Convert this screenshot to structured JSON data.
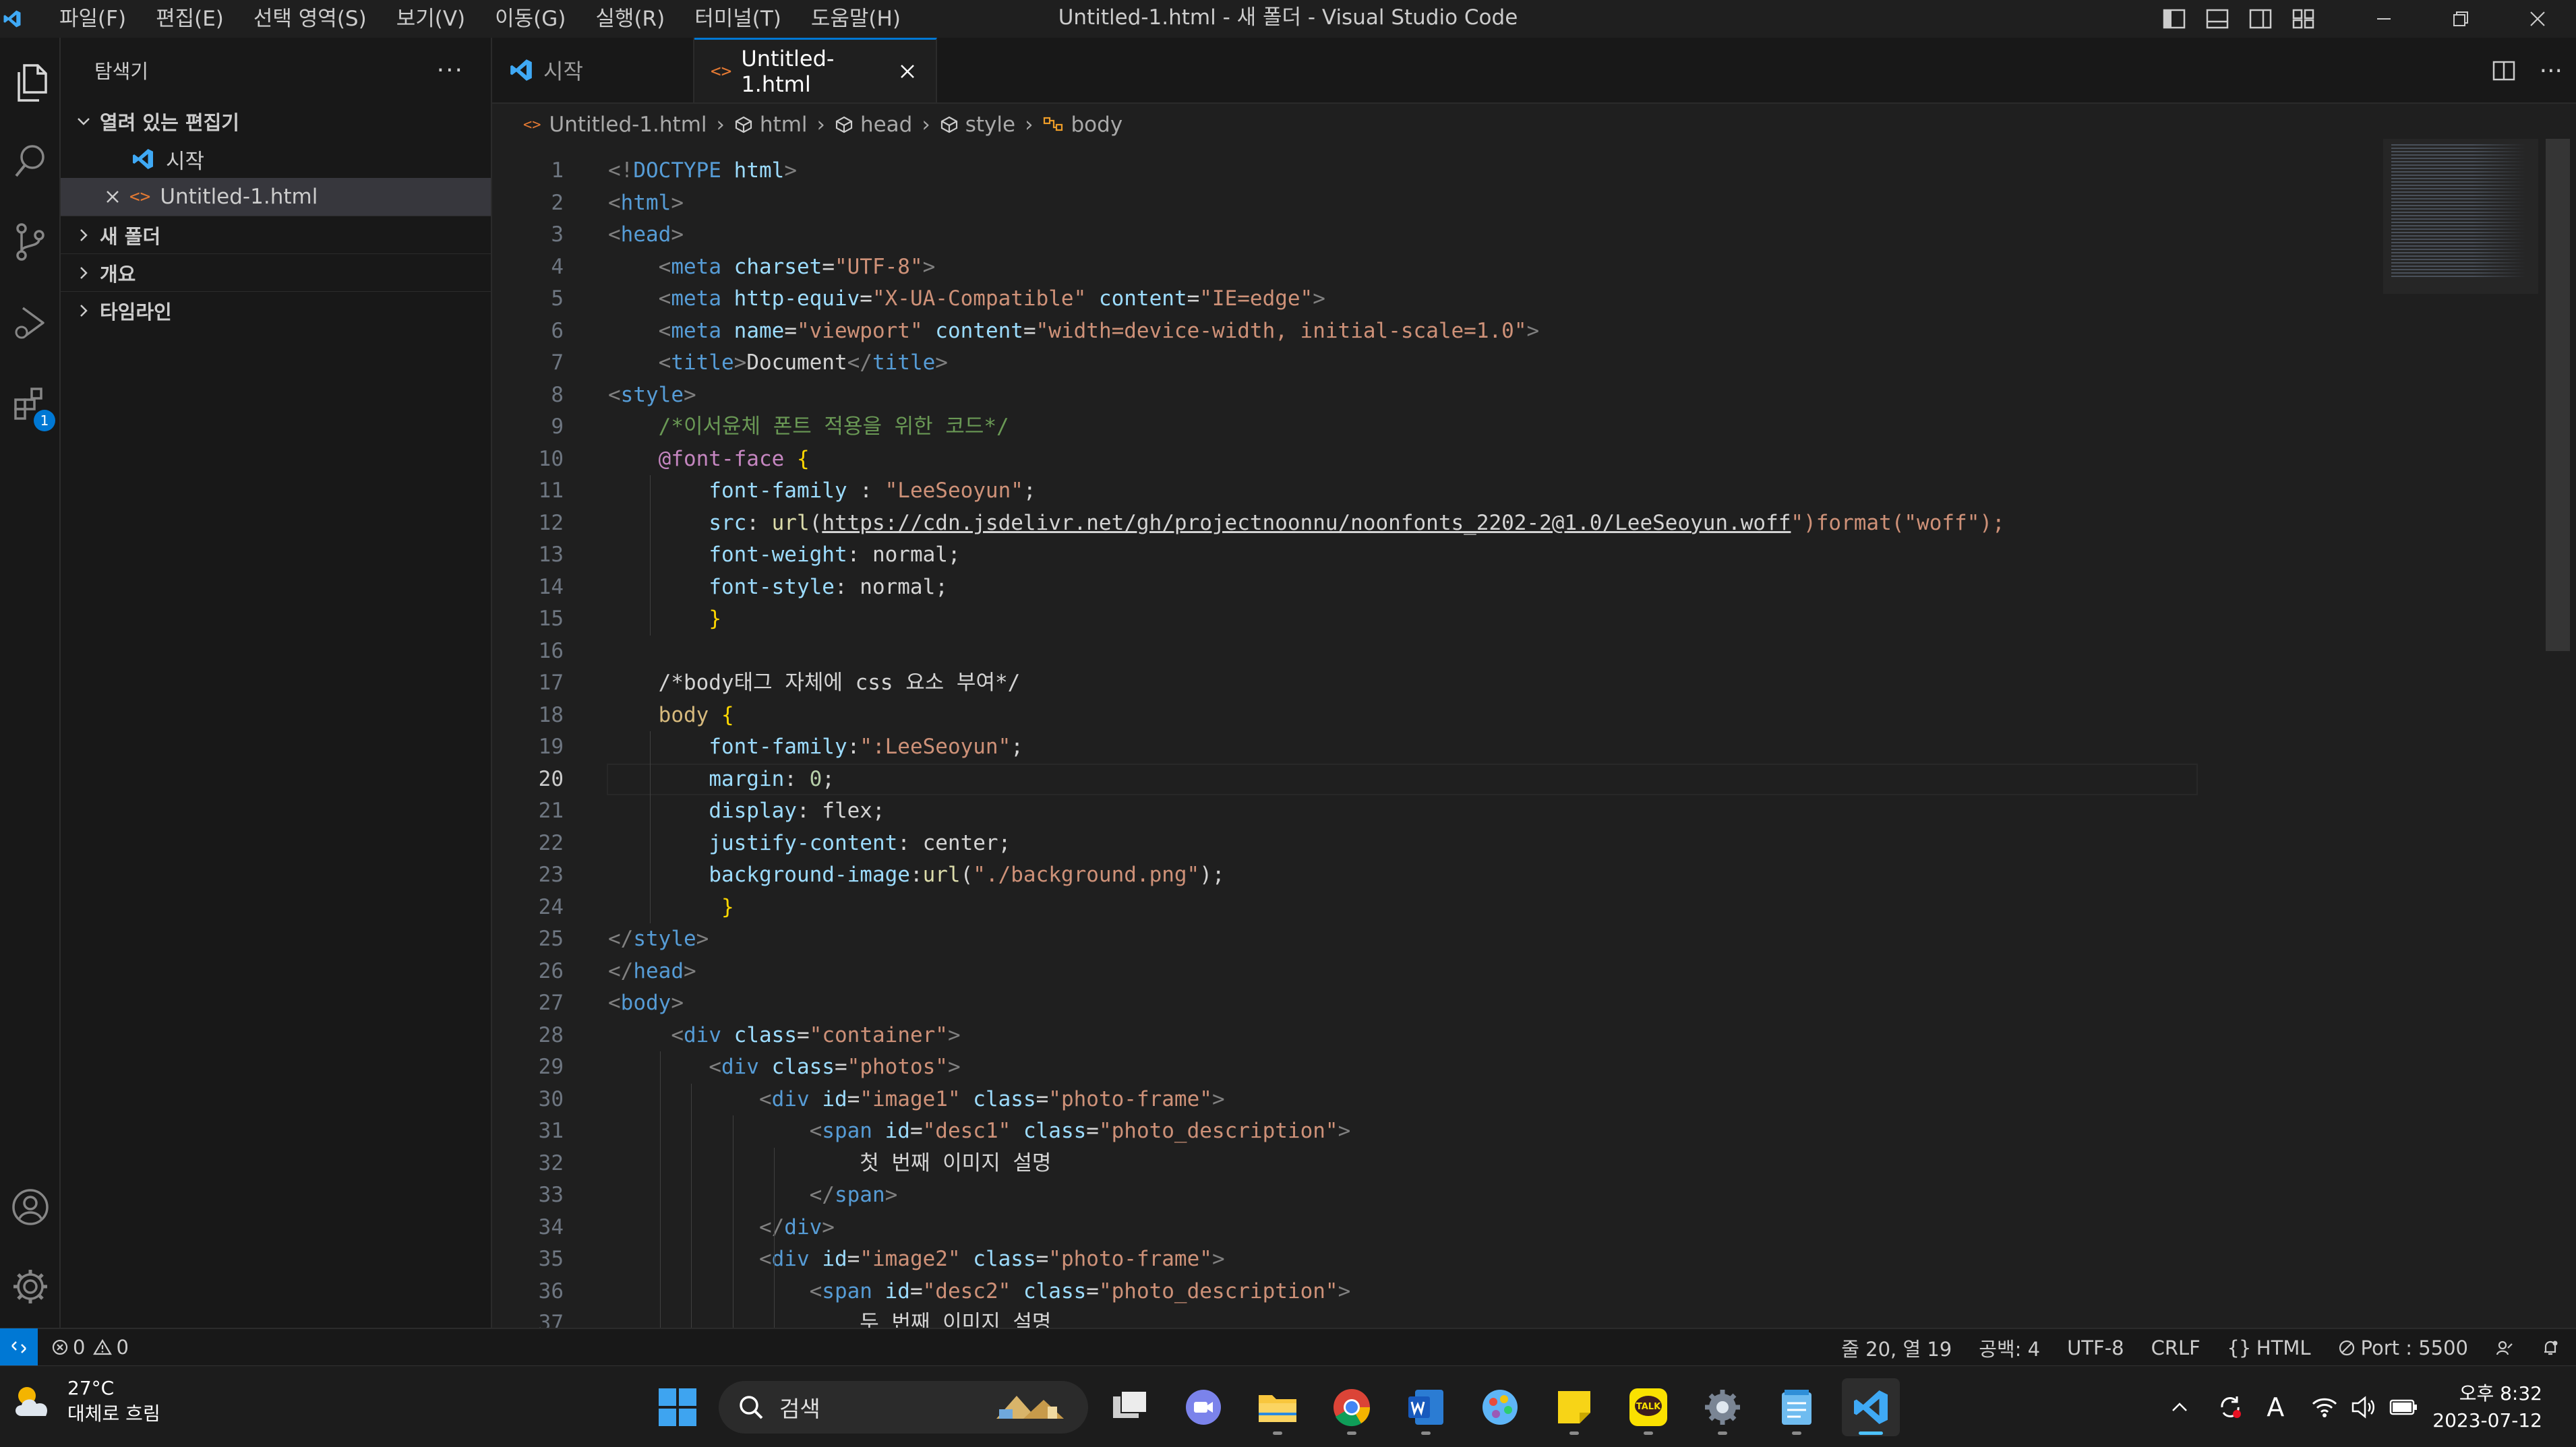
{
  "window": {
    "title": "Untitled-1.html - 새 폴더 - Visual Studio Code",
    "menu": [
      "파일(F)",
      "편집(E)",
      "선택 영역(S)",
      "보기(V)",
      "이동(G)",
      "실행(R)",
      "터미널(T)",
      "도움말(H)"
    ]
  },
  "activity_bar": {
    "items": [
      "explorer",
      "search",
      "source-control",
      "run-debug",
      "extensions"
    ],
    "extensions_badge": "1"
  },
  "sidebar": {
    "title": "탐색기",
    "more": "···",
    "open_editors_label": "열려 있는 편집기",
    "open_editors": [
      {
        "label": "시작",
        "icon": "vscode-icon"
      },
      {
        "label": "Untitled-1.html",
        "icon": "html-icon"
      }
    ],
    "sections": [
      "새 폴더",
      "개요",
      "타임라인"
    ]
  },
  "tabs": [
    {
      "label": "시작",
      "active": false
    },
    {
      "label": "Untitled-1.html",
      "active": true
    }
  ],
  "breadcrumb": [
    "Untitled-1.html",
    "html",
    "head",
    "style",
    "body"
  ],
  "code": {
    "current_line": 20,
    "lines": [
      [
        [
          "br",
          "<!"
        ],
        [
          "tag",
          "DOCTYPE"
        ],
        [
          "txt",
          " "
        ],
        [
          "attr",
          "html"
        ],
        [
          "br",
          ">"
        ]
      ],
      [
        [
          "br",
          "<"
        ],
        [
          "tag",
          "html"
        ],
        [
          "br",
          ">"
        ]
      ],
      [
        [
          "br",
          "<"
        ],
        [
          "tag",
          "head"
        ],
        [
          "br",
          ">"
        ]
      ],
      [
        [
          "txt",
          "    "
        ],
        [
          "br",
          "<"
        ],
        [
          "tag",
          "meta"
        ],
        [
          "txt",
          " "
        ],
        [
          "attr",
          "charset"
        ],
        [
          "txt",
          "="
        ],
        [
          "str",
          "\"UTF-8\""
        ],
        [
          "br",
          ">"
        ]
      ],
      [
        [
          "txt",
          "    "
        ],
        [
          "br",
          "<"
        ],
        [
          "tag",
          "meta"
        ],
        [
          "txt",
          " "
        ],
        [
          "attr",
          "http-equiv"
        ],
        [
          "txt",
          "="
        ],
        [
          "str",
          "\"X-UA-Compatible\""
        ],
        [
          "txt",
          " "
        ],
        [
          "attr",
          "content"
        ],
        [
          "txt",
          "="
        ],
        [
          "str",
          "\"IE=edge\""
        ],
        [
          "br",
          ">"
        ]
      ],
      [
        [
          "txt",
          "    "
        ],
        [
          "br",
          "<"
        ],
        [
          "tag",
          "meta"
        ],
        [
          "txt",
          " "
        ],
        [
          "attr",
          "name"
        ],
        [
          "txt",
          "="
        ],
        [
          "str",
          "\"viewport\""
        ],
        [
          "txt",
          " "
        ],
        [
          "attr",
          "content"
        ],
        [
          "txt",
          "="
        ],
        [
          "str",
          "\"width=device-width, initial-scale=1.0\""
        ],
        [
          "br",
          ">"
        ]
      ],
      [
        [
          "txt",
          "    "
        ],
        [
          "br",
          "<"
        ],
        [
          "tag",
          "title"
        ],
        [
          "br",
          ">"
        ],
        [
          "txt",
          "Document"
        ],
        [
          "br",
          "</"
        ],
        [
          "tag",
          "title"
        ],
        [
          "br",
          ">"
        ]
      ],
      [
        [
          "br",
          "<"
        ],
        [
          "tag",
          "style"
        ],
        [
          "br",
          ">"
        ]
      ],
      [
        [
          "txt",
          "    "
        ],
        [
          "cmt",
          "/*이서윤체 폰트 적용을 위한 코드*/"
        ]
      ],
      [
        [
          "txt",
          "    "
        ],
        [
          "at",
          "@font-face"
        ],
        [
          "txt",
          " "
        ],
        [
          "y",
          "{"
        ]
      ],
      [
        [
          "txt",
          "        "
        ],
        [
          "attr",
          "font-family"
        ],
        [
          "txt",
          " : "
        ],
        [
          "str",
          "\"LeeSeoyun\""
        ],
        [
          "txt",
          ";"
        ]
      ],
      [
        [
          "txt",
          "        "
        ],
        [
          "attr",
          "src"
        ],
        [
          "txt",
          ": "
        ],
        [
          "fn",
          "url"
        ],
        [
          "txt",
          "("
        ],
        [
          "url",
          "https://cdn.jsdelivr.net/gh/projectnoonnu/noonfonts_2202-2@1.0/LeeSeoyun.woff"
        ],
        [
          "str",
          "\")format(\"woff\");"
        ]
      ],
      [
        [
          "txt",
          "        "
        ],
        [
          "attr",
          "font-weight"
        ],
        [
          "txt",
          ": normal;"
        ]
      ],
      [
        [
          "txt",
          "        "
        ],
        [
          "attr",
          "font-style"
        ],
        [
          "txt",
          ": normal;"
        ]
      ],
      [
        [
          "txt",
          "        "
        ],
        [
          "y",
          "}"
        ]
      ],
      [],
      [
        [
          "txt",
          "    "
        ],
        [
          "txt",
          "/*body태그 자체에 css 요소 부여*/"
        ]
      ],
      [
        [
          "txt",
          "    "
        ],
        [
          "sel",
          "body"
        ],
        [
          "txt",
          " "
        ],
        [
          "y",
          "{"
        ]
      ],
      [
        [
          "txt",
          "        "
        ],
        [
          "attr",
          "font-family"
        ],
        [
          "txt",
          ":"
        ],
        [
          "str",
          "\":LeeSeoyun\""
        ],
        [
          "txt",
          ";"
        ]
      ],
      [
        [
          "txt",
          "        "
        ],
        [
          "attr",
          "margin"
        ],
        [
          "txt",
          ": "
        ],
        [
          "num",
          "0"
        ],
        [
          "txt",
          ";"
        ]
      ],
      [
        [
          "txt",
          "        "
        ],
        [
          "attr",
          "display"
        ],
        [
          "txt",
          ": flex;"
        ]
      ],
      [
        [
          "txt",
          "        "
        ],
        [
          "attr",
          "justify-content"
        ],
        [
          "txt",
          ": center;"
        ]
      ],
      [
        [
          "txt",
          "        "
        ],
        [
          "attr",
          "background-image"
        ],
        [
          "txt",
          ":"
        ],
        [
          "fn",
          "url"
        ],
        [
          "txt",
          "("
        ],
        [
          "str",
          "\"./background.png\""
        ],
        [
          "txt",
          ");"
        ]
      ],
      [
        [
          "txt",
          "         "
        ],
        [
          "y",
          "}"
        ]
      ],
      [
        [
          "br",
          "</"
        ],
        [
          "tag",
          "style"
        ],
        [
          "br",
          ">"
        ]
      ],
      [
        [
          "br",
          "</"
        ],
        [
          "tag",
          "head"
        ],
        [
          "br",
          ">"
        ]
      ],
      [
        [
          "br",
          "<"
        ],
        [
          "tag",
          "body"
        ],
        [
          "br",
          ">"
        ]
      ],
      [
        [
          "txt",
          "     "
        ],
        [
          "br",
          "<"
        ],
        [
          "tag",
          "div"
        ],
        [
          "txt",
          " "
        ],
        [
          "attr",
          "class"
        ],
        [
          "txt",
          "="
        ],
        [
          "str",
          "\"container\""
        ],
        [
          "br",
          ">"
        ]
      ],
      [
        [
          "txt",
          "        "
        ],
        [
          "br",
          "<"
        ],
        [
          "tag",
          "div"
        ],
        [
          "txt",
          " "
        ],
        [
          "attr",
          "class"
        ],
        [
          "txt",
          "="
        ],
        [
          "str",
          "\"photos\""
        ],
        [
          "br",
          ">"
        ]
      ],
      [
        [
          "txt",
          "            "
        ],
        [
          "br",
          "<"
        ],
        [
          "tag",
          "div"
        ],
        [
          "txt",
          " "
        ],
        [
          "attr",
          "id"
        ],
        [
          "txt",
          "="
        ],
        [
          "str",
          "\"image1\""
        ],
        [
          "txt",
          " "
        ],
        [
          "attr",
          "class"
        ],
        [
          "txt",
          "="
        ],
        [
          "str",
          "\"photo-frame\""
        ],
        [
          "br",
          ">"
        ]
      ],
      [
        [
          "txt",
          "                "
        ],
        [
          "br",
          "<"
        ],
        [
          "tag",
          "span"
        ],
        [
          "txt",
          " "
        ],
        [
          "attr",
          "id"
        ],
        [
          "txt",
          "="
        ],
        [
          "str",
          "\"desc1\""
        ],
        [
          "txt",
          " "
        ],
        [
          "attr",
          "class"
        ],
        [
          "txt",
          "="
        ],
        [
          "str",
          "\"photo_description\""
        ],
        [
          "br",
          ">"
        ]
      ],
      [
        [
          "txt",
          "                    첫 번째 이미지 설명"
        ]
      ],
      [
        [
          "txt",
          "                "
        ],
        [
          "br",
          "</"
        ],
        [
          "tag",
          "span"
        ],
        [
          "br",
          ">"
        ]
      ],
      [
        [
          "txt",
          "            "
        ],
        [
          "br",
          "</"
        ],
        [
          "tag",
          "div"
        ],
        [
          "br",
          ">"
        ]
      ],
      [
        [
          "txt",
          "            "
        ],
        [
          "br",
          "<"
        ],
        [
          "tag",
          "div"
        ],
        [
          "txt",
          " "
        ],
        [
          "attr",
          "id"
        ],
        [
          "txt",
          "="
        ],
        [
          "str",
          "\"image2\""
        ],
        [
          "txt",
          " "
        ],
        [
          "attr",
          "class"
        ],
        [
          "txt",
          "="
        ],
        [
          "str",
          "\"photo-frame\""
        ],
        [
          "br",
          ">"
        ]
      ],
      [
        [
          "txt",
          "                "
        ],
        [
          "br",
          "<"
        ],
        [
          "tag",
          "span"
        ],
        [
          "txt",
          " "
        ],
        [
          "attr",
          "id"
        ],
        [
          "txt",
          "="
        ],
        [
          "str",
          "\"desc2\""
        ],
        [
          "txt",
          " "
        ],
        [
          "attr",
          "class"
        ],
        [
          "txt",
          "="
        ],
        [
          "str",
          "\"photo_description\""
        ],
        [
          "br",
          ">"
        ]
      ],
      [
        [
          "txt",
          "                    두 번째 이미지 설명"
        ]
      ]
    ]
  },
  "status_bar": {
    "errors": "0",
    "warnings": "0",
    "position": "줄 20, 열 19",
    "indent": "공백: 4",
    "encoding": "UTF-8",
    "eol": "CRLF",
    "language": "HTML",
    "port": "Port : 5500"
  },
  "taskbar": {
    "weather_temp": "27°C",
    "weather_desc": "대체로 흐림",
    "search_placeholder": "검색",
    "clock_time": "오후 8:32",
    "clock_date": "2023-07-12",
    "ime": "A"
  },
  "colors": {
    "accent": "#0078d4",
    "editor_bg": "#1f1f1f",
    "sidebar_bg": "#181818"
  }
}
